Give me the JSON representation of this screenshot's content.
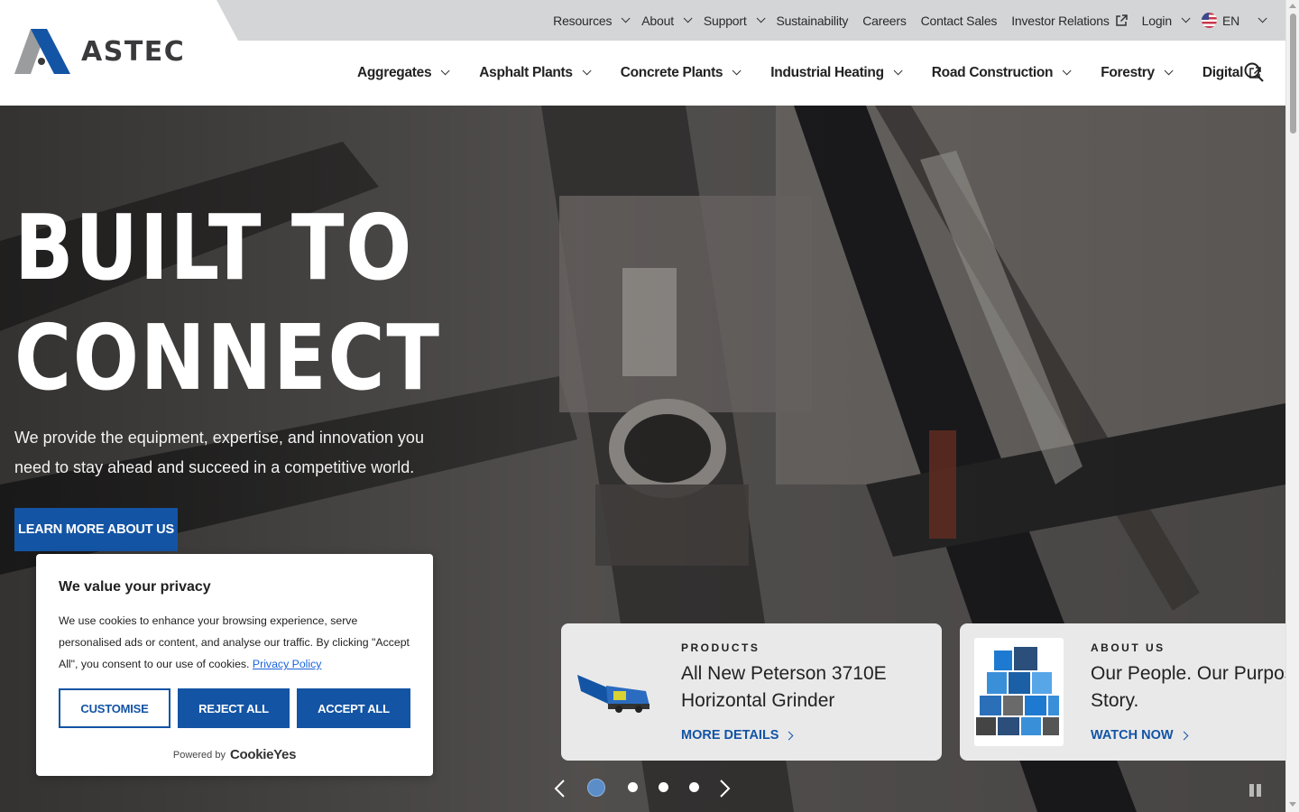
{
  "header": {
    "logo_text": "ASTEC",
    "utility_nav": [
      {
        "label": "Resources",
        "has_dropdown": true
      },
      {
        "label": "About",
        "has_dropdown": true
      },
      {
        "label": "Support",
        "has_dropdown": true
      },
      {
        "label": "Sustainability"
      },
      {
        "label": "Careers"
      },
      {
        "label": "Contact Sales"
      },
      {
        "label": "Investor Relations",
        "external": true
      },
      {
        "label": "Login",
        "has_dropdown": true
      }
    ],
    "language": {
      "label": "EN",
      "flag": "us-flag-icon"
    },
    "main_nav": [
      {
        "label": "Aggregates"
      },
      {
        "label": "Asphalt Plants"
      },
      {
        "label": "Concrete Plants"
      },
      {
        "label": "Industrial Heating"
      },
      {
        "label": "Road Construction"
      },
      {
        "label": "Forestry"
      },
      {
        "label": "Digital",
        "external": true
      }
    ],
    "search_icon": "search-icon"
  },
  "hero": {
    "title_line1": "BUILT TO",
    "title_line2": "CONNECT",
    "subtitle": "We provide the equipment, expertise, and innovation you need to stay ahead and succeed in a competitive world.",
    "cta_label": "LEARN MORE ABOUT US"
  },
  "cards": [
    {
      "eyebrow": "PRODUCTS",
      "title": "All New Peterson 3710E Horizontal Grinder",
      "link": "MORE DETAILS",
      "thumb": "grinder-machine-image"
    },
    {
      "eyebrow": "ABOUT US",
      "title": "Our People. Our Purpose. Our Story.",
      "link": "WATCH NOW",
      "thumb": "people-collage-image"
    }
  ],
  "carousel": {
    "slides": 4,
    "active_index": 0,
    "paused_icon": "pause-icon"
  },
  "cookie": {
    "title": "We value your privacy",
    "text": "We use cookies to enhance your browsing experience, serve personalised ads or content, and analyse our traffic. By clicking \"Accept All\", you consent to our use of cookies.",
    "privacy_link": "Privacy Policy",
    "customise": "CUSTOMISE",
    "reject": "REJECT ALL",
    "accept": "ACCEPT ALL",
    "powered_label": "Powered by",
    "powered_brand": "CookieYes"
  },
  "colors": {
    "brand_blue": "#1354a4",
    "utility_bar": "#d4d5d7",
    "dot_active": "#5b8dc9"
  }
}
